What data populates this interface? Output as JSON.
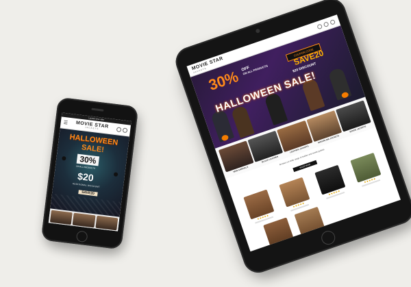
{
  "tablet": {
    "logo_main": "MOVIE STAR",
    "logo_sub": "JACKETS",
    "hero": {
      "promo_percent": "30%",
      "promo_line1": "OFF",
      "promo_line2": "ON ALL PRODUCTS",
      "headline": "HALLOWEEN SALE!",
      "coupon_label": "COUPON CODE",
      "coupon_code": "SAVE20",
      "discount": "$20 DISCOUNT"
    },
    "categories": [
      {
        "label": "NEW ARRIVALS"
      },
      {
        "label": "BLACK LEATHER"
      },
      {
        "label": "LEATHER JACKETS"
      },
      {
        "label": "SHEARLING JACKETS"
      },
      {
        "label": "SUEDE JACKETS"
      }
    ],
    "section_text": "Browse our wide range of leather and suede jackets",
    "section_button": "SHOP NOW",
    "colors": {
      "accent": "#ff8a1a",
      "dark": "#111111"
    }
  },
  "phone": {
    "top_bar": "Limited time offer",
    "logo_main": "MOVIE STAR",
    "logo_sub": "JACKETS",
    "hero": {
      "line1": "HALLOWEEN",
      "line2": "SALE!",
      "percent": "30%",
      "percent_sub": "ON ALL PRODUCTS",
      "price": "$20",
      "price_sub": "ADDITIONAL DISCOUNT",
      "code": "SAVE20"
    },
    "icons": [
      "menu-icon",
      "search-icon",
      "cart-icon"
    ]
  }
}
